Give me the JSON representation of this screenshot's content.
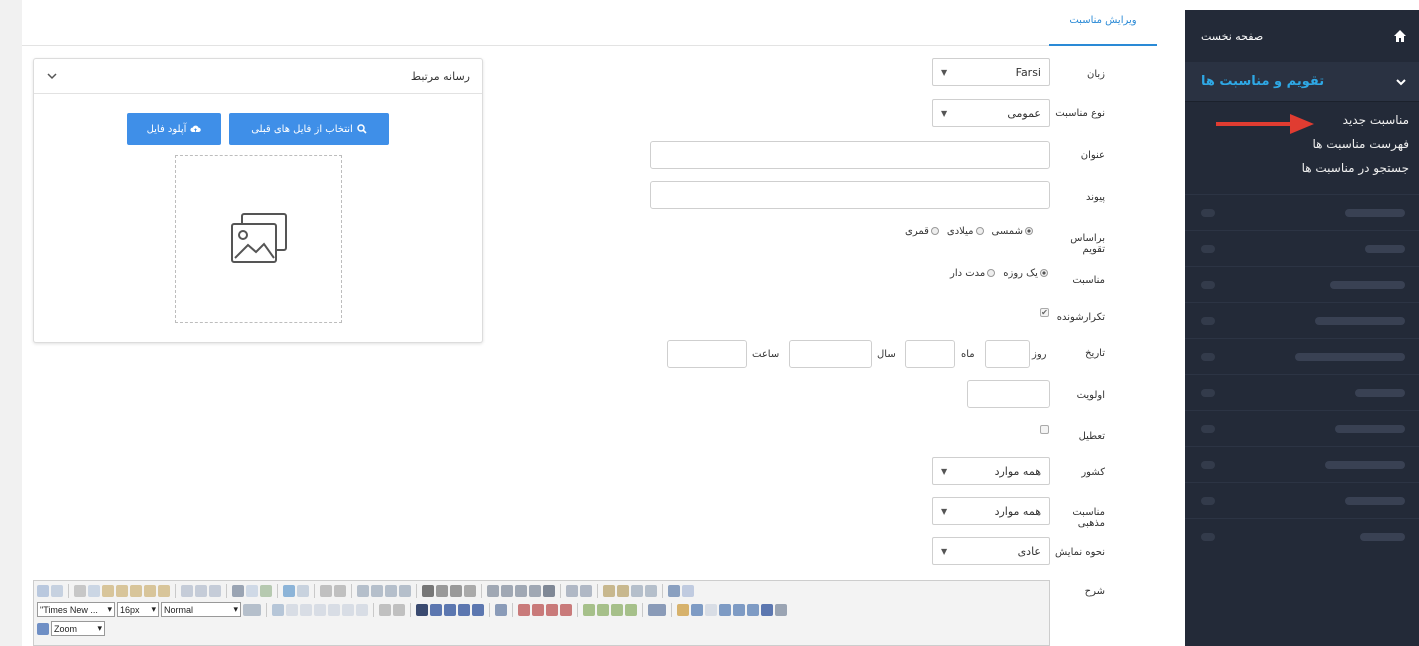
{
  "sidebar": {
    "home_label": "صفحه نخست",
    "section_label": "تقویم و مناسبت ها",
    "sub_items": [
      "مناسبت جدید",
      "فهرست مناسبت ها",
      "جستجو در مناسبت ها"
    ],
    "accent_color": "#2ea8e5",
    "background": "#232a38"
  },
  "tabs": {
    "active_label": "ویرایش مناسبت"
  },
  "form": {
    "language": {
      "label": "زبان",
      "value": "Farsi"
    },
    "occasion_type": {
      "label": "نوع مناسبت",
      "value": "عمومی"
    },
    "title": {
      "label": "عنوان",
      "value": ""
    },
    "link": {
      "label": "پیوند",
      "value": ""
    },
    "calendar_basis": {
      "label": "براساس تقویم",
      "options": [
        "شمسی",
        "میلادی",
        "قمری"
      ],
      "selected": "شمسی"
    },
    "occasion": {
      "label": "مناسبت",
      "options": [
        "یک روزه",
        "مدت دار"
      ],
      "selected": "یک روزه"
    },
    "recurring": {
      "label": "تکرارشونده",
      "checked": true
    },
    "date": {
      "label": "تاریخ",
      "day_label": "روز",
      "month_label": "ماه",
      "year_label": "سال",
      "hour_label": "ساعت"
    },
    "priority": {
      "label": "اولویت",
      "value": ""
    },
    "holiday": {
      "label": "تعطیل",
      "checked": false
    },
    "country": {
      "label": "کشور",
      "value": "همه موارد"
    },
    "religious": {
      "label": "مناسبت مذهبی",
      "value": "همه موارد"
    },
    "display_mode": {
      "label": "نحوه نمایش",
      "value": "عادی"
    },
    "description": {
      "label": "شرح"
    }
  },
  "media": {
    "title": "رسانه مرتبط",
    "select_previous_label": "انتخاب از فایل های قبلی",
    "upload_label": "آپلود فایل"
  },
  "editor": {
    "font_family": "\"Times New ...",
    "font_size": "16px",
    "format": "Normal",
    "zoom": "Zoom"
  }
}
